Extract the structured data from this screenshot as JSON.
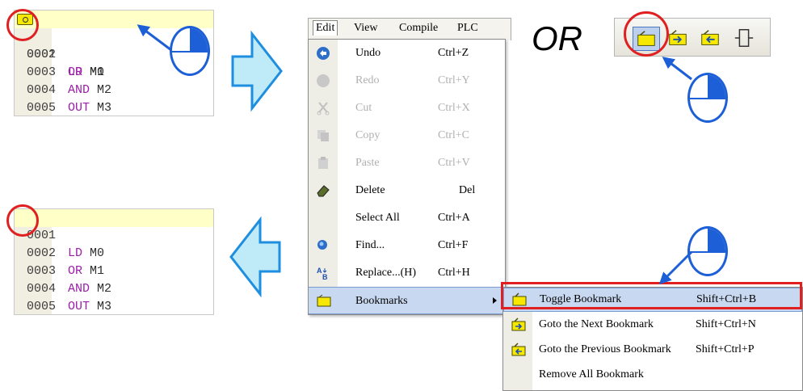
{
  "top_code_panel": {
    "lines": [
      {
        "num": "0001",
        "op": "LD",
        "arg": "M0",
        "highlight": true,
        "bookmark": true
      },
      {
        "num": "0002",
        "op": "OR",
        "arg": "M1"
      },
      {
        "num": "0003",
        "op": "AND",
        "arg": "M2"
      },
      {
        "num": "0004",
        "op": "OUT",
        "arg": "M3"
      },
      {
        "num": "0005",
        "op": "",
        "arg": ""
      }
    ]
  },
  "bottom_code_panel": {
    "lines": [
      {
        "num": "0001",
        "op": "LD",
        "arg": "M0",
        "highlight": true
      },
      {
        "num": "0002",
        "op": "OR",
        "arg": "M1"
      },
      {
        "num": "0003",
        "op": "AND",
        "arg": "M2"
      },
      {
        "num": "0004",
        "op": "OUT",
        "arg": "M3"
      },
      {
        "num": "0005",
        "op": "",
        "arg": ""
      }
    ]
  },
  "menubar": {
    "items": [
      "Edit",
      "View",
      "Compile",
      "PLC"
    ]
  },
  "edit_menu": {
    "items": [
      {
        "label": "Undo",
        "shortcut": "Ctrl+Z",
        "icon": "undo-icon",
        "enabled": true
      },
      {
        "label": "Redo",
        "shortcut": "Ctrl+Y",
        "icon": "redo-icon",
        "enabled": false
      },
      {
        "label": "Cut",
        "shortcut": "Ctrl+X",
        "icon": "cut-icon",
        "enabled": false
      },
      {
        "label": "Copy",
        "shortcut": "Ctrl+C",
        "icon": "copy-icon",
        "enabled": false
      },
      {
        "label": "Paste",
        "shortcut": "Ctrl+V",
        "icon": "paste-icon",
        "enabled": false
      },
      {
        "label": "Delete",
        "shortcut": "Del",
        "icon": "eraser-icon",
        "enabled": true
      },
      {
        "label": "Select All",
        "shortcut": "Ctrl+A",
        "icon": "",
        "enabled": true
      },
      {
        "label": "Find...",
        "shortcut": "Ctrl+F",
        "icon": "find-icon",
        "enabled": true
      },
      {
        "label": "Replace...(H)",
        "shortcut": "Ctrl+H",
        "icon": "replace-icon",
        "enabled": true
      },
      {
        "label": "Bookmarks",
        "shortcut": "",
        "icon": "bookmark-icon",
        "enabled": true,
        "submenu": true
      }
    ]
  },
  "bookmarks_submenu": {
    "items": [
      {
        "label": "Toggle Bookmark",
        "shortcut": "Shift+Ctrl+B",
        "icon": "toggle-bookmark-icon"
      },
      {
        "label": "Goto the Next Bookmark",
        "shortcut": "Shift+Ctrl+N",
        "icon": "next-bookmark-icon"
      },
      {
        "label": "Goto the Previous Bookmark",
        "shortcut": "Shift+Ctrl+P",
        "icon": "previous-bookmark-icon"
      },
      {
        "label": "Remove All Bookmark",
        "shortcut": "",
        "icon": ""
      }
    ]
  },
  "or_label": "OR",
  "toolbar": {
    "buttons": [
      "toggle-bookmark-icon",
      "next-bookmark-icon",
      "previous-bookmark-icon",
      "remove-all-bookmarks-icon"
    ]
  },
  "colors": {
    "annotation_red": "#e02020",
    "mouse_blue": "#1d5fd6",
    "arrow_fill": "#bfeaf7",
    "arrow_stroke": "#1e8ee0",
    "instruction_purple": "#9b1fa8",
    "highlight_yellow": "#ffffc8"
  }
}
